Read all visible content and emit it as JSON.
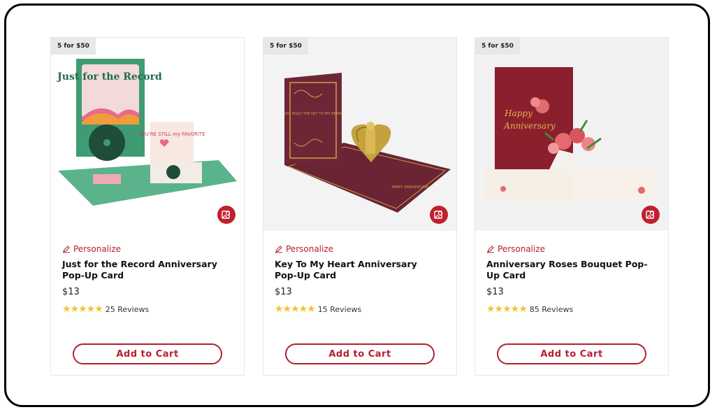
{
  "products": [
    {
      "badge": "5 for $50",
      "personalize_label": "Personalize",
      "title": "Just for the Record Anniversary Pop-Up Card",
      "price": "$13",
      "stars": "★★★★★",
      "reviews": "25 Reviews",
      "cart_label": "Add to Cart",
      "card_text_1": "Just for the Record",
      "card_text_2": "YOU'RE STILL my FAVORITE"
    },
    {
      "badge": "5 for $50",
      "personalize_label": "Personalize",
      "title": "Key To My Heart Anniversary Pop-Up Card",
      "price": "$13",
      "stars": "★★★★★",
      "reviews": "15 Reviews",
      "cart_label": "Add to Cart",
      "card_text_1": "YOU HOLD THE KEY TO MY HEART",
      "card_text_2": "HAPPY ANNIVERSARY"
    },
    {
      "badge": "5 for $50",
      "personalize_label": "Personalize",
      "title": "Anniversary Roses Bouquet Pop-Up Card",
      "price": "$13",
      "stars": "★★★★★",
      "reviews": "85 Reviews",
      "cart_label": "Add to Cart",
      "card_text_1": "Happy",
      "card_text_2": "Anniversary"
    }
  ],
  "colors": {
    "accent": "#b3202f",
    "star": "#f2c230",
    "badge_bg": "#e8e8e8"
  }
}
